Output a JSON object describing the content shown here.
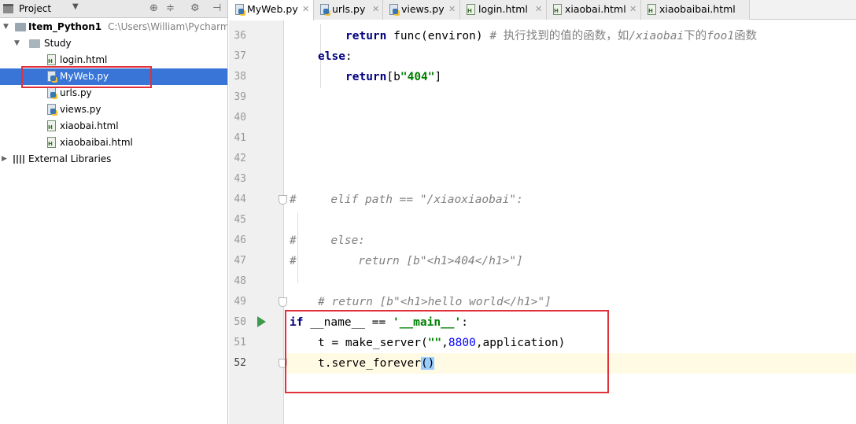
{
  "project_panel": {
    "title": "Project",
    "tree": [
      {
        "label": "Item_Python1",
        "path": "C:\\Users\\William\\PycharmPr",
        "type": "folder"
      },
      {
        "label": "Study",
        "type": "folder"
      },
      {
        "label": "login.html",
        "type": "html"
      },
      {
        "label": "MyWeb.py",
        "type": "py",
        "selected": true
      },
      {
        "label": "urls.py",
        "type": "py"
      },
      {
        "label": "views.py",
        "type": "py"
      },
      {
        "label": "xiaobai.html",
        "type": "html"
      },
      {
        "label": "xiaobaibai.html",
        "type": "html"
      },
      {
        "label": "External Libraries",
        "type": "libraries"
      }
    ]
  },
  "tabs": [
    {
      "label": "MyWeb.py",
      "type": "py",
      "active": true
    },
    {
      "label": "urls.py",
      "type": "py"
    },
    {
      "label": "views.py",
      "type": "py"
    },
    {
      "label": "login.html",
      "type": "html"
    },
    {
      "label": "xiaobai.html",
      "type": "html"
    },
    {
      "label": "xiaobaibai.html",
      "type": "html"
    }
  ],
  "line_numbers": [
    "36",
    "37",
    "38",
    "39",
    "40",
    "41",
    "42",
    "43",
    "44",
    "45",
    "46",
    "47",
    "48",
    "49",
    "50",
    "51",
    "52"
  ],
  "code": {
    "l36": {
      "kw": "return",
      "plain": " func(environ) ",
      "cmt1": "# ",
      "cjk1": "执行找到的值的函数，如",
      "cmt2": "/xiaobai",
      "cjk2": "下的",
      "cmt3": "foo1",
      "cjk3": "函数"
    },
    "l37": {
      "kw": "else",
      "plain": ":"
    },
    "l38": {
      "kw": "return",
      "plain1": "[b",
      "str": "\"404\"",
      "plain2": "]"
    },
    "l44": {
      "cmt": "#     elif path == \"/xiaoxiaobai\":"
    },
    "l46": {
      "cmt": "#     else:"
    },
    "l47": {
      "cmt": "#         return [b\"<h1>404</h1>\"]"
    },
    "l49": {
      "cmt": "# return [b\"<h1>hello world</h1>\"]"
    },
    "l50": {
      "kw": "if",
      "plain1": " __name__ == ",
      "str": "'__main__'",
      "plain2": ":"
    },
    "l51": {
      "plain1": "t = make_server(",
      "str": "\"\"",
      "plain2": ",",
      "num": "8800",
      "plain3": ",application)"
    },
    "l52": {
      "plain1": "t.serve_forever",
      "paren": "()"
    }
  },
  "colors": {
    "keyword": "#000080",
    "string": "#008000",
    "number": "#0000ff",
    "comment": "#808080",
    "selection": "#3875d7",
    "highlight_box": "#e0303a",
    "current_line": "#fffae3"
  }
}
